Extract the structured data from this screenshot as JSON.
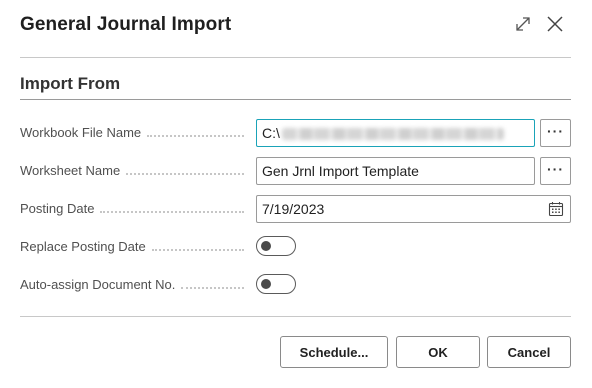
{
  "dialog": {
    "title": "General Journal Import",
    "expand_icon": "expand-diagonal-icon",
    "close_icon": "close-icon"
  },
  "section": {
    "title": "Import From"
  },
  "fields": {
    "workbook_file_name": {
      "label": "Workbook File Name",
      "value_prefix": "C:\\",
      "value_obscured": true,
      "lookup_label": "···"
    },
    "worksheet_name": {
      "label": "Worksheet Name",
      "value": "Gen Jrnl Import Template",
      "lookup_label": "···"
    },
    "posting_date": {
      "label": "Posting Date",
      "value": "7/19/2023",
      "icon": "calendar-icon"
    },
    "replace_posting_date": {
      "label": "Replace Posting Date",
      "checked": false
    },
    "auto_assign_document_no": {
      "label": "Auto-assign Document No.",
      "checked": false
    }
  },
  "buttons": {
    "schedule": "Schedule...",
    "ok": "OK",
    "cancel": "Cancel"
  },
  "colors": {
    "focus_border": "#1aa3b8",
    "border": "#9a9a9a",
    "text": "#212121"
  }
}
